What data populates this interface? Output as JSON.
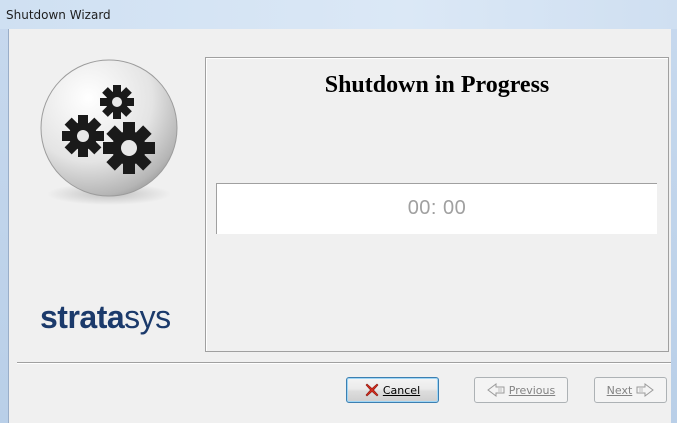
{
  "window": {
    "title": "Shutdown Wizard"
  },
  "branding": {
    "logo_icon": "gears-icon",
    "brand_bold": "strata",
    "brand_light": "sys",
    "brand_color": "#1b3a6b"
  },
  "panel": {
    "title": "Shutdown in Progress",
    "timer": "00: 00"
  },
  "buttons": {
    "cancel": {
      "label": "Cancel",
      "icon": "red-x-icon",
      "accent": "#d52b1e"
    },
    "previous": {
      "label": "Previous",
      "icon": "left-arrow-icon",
      "enabled": false
    },
    "next": {
      "label": "Next",
      "icon": "right-arrow-icon",
      "enabled": false
    }
  }
}
